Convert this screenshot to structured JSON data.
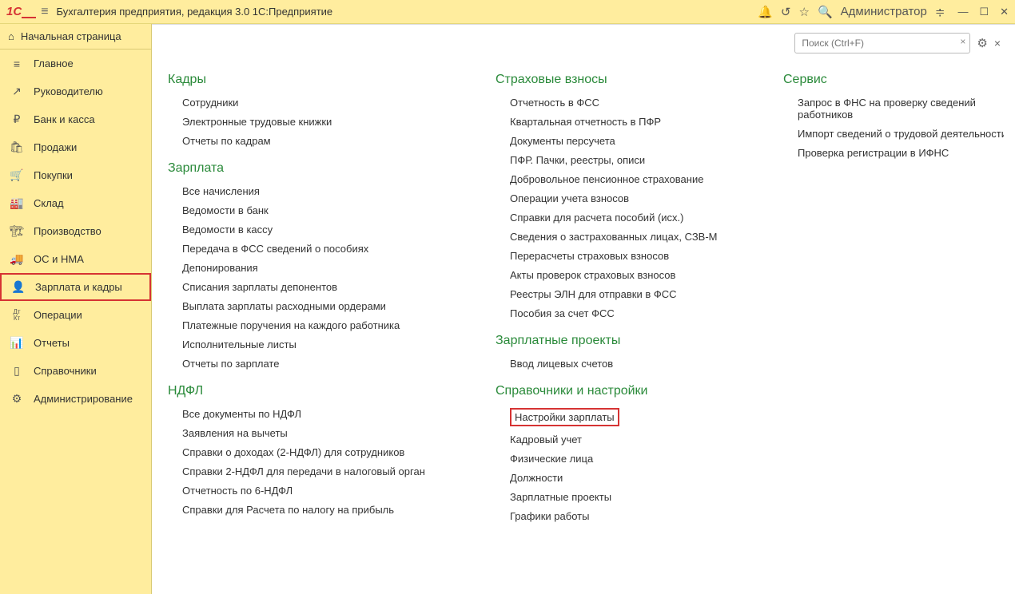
{
  "title": "Бухгалтерия предприятия, редакция 3.0 1С:Предприятие",
  "user": "Администратор",
  "home": "Начальная страница",
  "search": {
    "placeholder": "Поиск (Ctrl+F)"
  },
  "sidebar": [
    {
      "icon": "≡",
      "label": "Главное"
    },
    {
      "icon": "↗",
      "label": "Руководителю"
    },
    {
      "icon": "₽",
      "label": "Банк и касса"
    },
    {
      "icon": "🛍",
      "label": "Продажи"
    },
    {
      "icon": "🛒",
      "label": "Покупки"
    },
    {
      "icon": "🏭",
      "label": "Склад"
    },
    {
      "icon": "🏗",
      "label": "Производство"
    },
    {
      "icon": "🚚",
      "label": "ОС и НМА"
    },
    {
      "icon": "👤",
      "label": "Зарплата и кадры",
      "active": true
    },
    {
      "icon": "Дт Кт",
      "label": "Операции"
    },
    {
      "icon": "📊",
      "label": "Отчеты"
    },
    {
      "icon": "▯",
      "label": "Справочники"
    },
    {
      "icon": "⚙",
      "label": "Администрирование"
    }
  ],
  "columns": [
    {
      "sections": [
        {
          "title": "Кадры",
          "items": [
            "Сотрудники",
            "Электронные трудовые книжки",
            "Отчеты по кадрам"
          ]
        },
        {
          "title": "Зарплата",
          "items": [
            "Все начисления",
            "Ведомости в банк",
            "Ведомости в кассу",
            "Передача в ФСС сведений о пособиях",
            "Депонирования",
            "Списания зарплаты депонентов",
            "Выплата зарплаты расходными ордерами",
            "Платежные поручения на каждого работника",
            "Исполнительные листы",
            "Отчеты по зарплате"
          ]
        },
        {
          "title": "НДФЛ",
          "items": [
            "Все документы по НДФЛ",
            "Заявления на вычеты",
            "Справки о доходах (2-НДФЛ) для сотрудников",
            "Справки 2-НДФЛ для передачи в налоговый орган",
            "Отчетность по 6-НДФЛ",
            "Справки для Расчета по налогу на прибыль"
          ]
        }
      ]
    },
    {
      "sections": [
        {
          "title": "Страховые взносы",
          "items": [
            "Отчетность в ФСС",
            "Квартальная отчетность в ПФР",
            "Документы персучета",
            "ПФР. Пачки, реестры, описи",
            "Добровольное пенсионное страхование",
            "Операции учета взносов",
            "Справки для расчета пособий (исх.)",
            "Сведения о застрахованных лицах, СЗВ-М",
            "Перерасчеты страховых взносов",
            "Акты проверок страховых взносов",
            "Реестры ЭЛН для отправки в ФСС",
            "Пособия за счет ФСС"
          ]
        },
        {
          "title": "Зарплатные проекты",
          "items": [
            "Ввод лицевых счетов"
          ]
        },
        {
          "title": "Справочники и настройки",
          "items": [
            {
              "text": "Настройки зарплаты",
              "hl": true
            },
            "Кадровый учет",
            "Физические лица",
            "Должности",
            "Зарплатные проекты",
            "Графики работы"
          ]
        }
      ]
    },
    {
      "sections": [
        {
          "title": "Сервис",
          "items": [
            "Запрос в ФНС на проверку сведений работников",
            "Импорт сведений о трудовой деятельности",
            "Проверка регистрации в ИФНС"
          ]
        }
      ]
    }
  ]
}
